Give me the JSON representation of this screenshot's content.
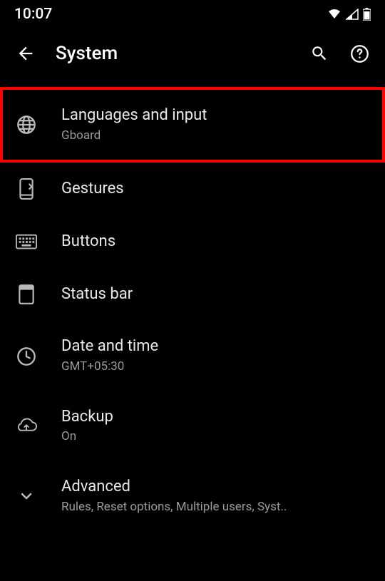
{
  "status_bar": {
    "time": "10:07"
  },
  "app_bar": {
    "title": "System"
  },
  "items": [
    {
      "title": "Languages and input",
      "sub": "Gboard"
    },
    {
      "title": "Gestures",
      "sub": null
    },
    {
      "title": "Buttons",
      "sub": null
    },
    {
      "title": "Status bar",
      "sub": null
    },
    {
      "title": "Date and time",
      "sub": "GMT+05:30"
    },
    {
      "title": "Backup",
      "sub": "On"
    },
    {
      "title": "Advanced",
      "sub": "Rules, Reset options, Multiple users, Syst.."
    }
  ]
}
